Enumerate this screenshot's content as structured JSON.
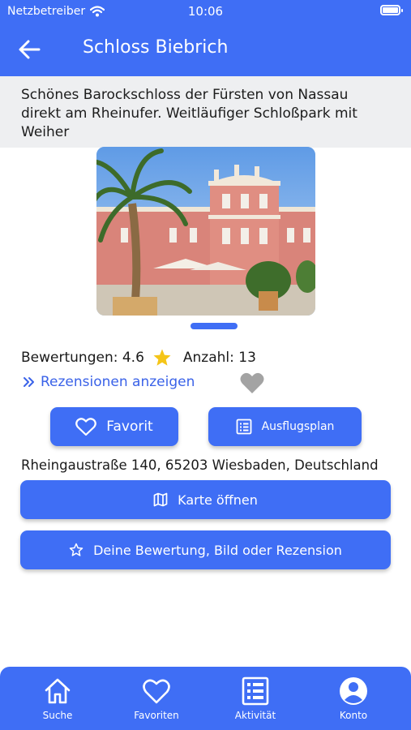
{
  "status_bar": {
    "carrier": "Netzbetreiber",
    "time": "10:06"
  },
  "header": {
    "title": "Schloss Biebrich"
  },
  "description": "Schönes Barockschloss der Fürsten von Nassau direkt am Rheinufer. Weitläufiger Schloßpark mit Weiher",
  "rating": {
    "label": "Bewertungen: 4.6",
    "count_label": "Anzahl: 13"
  },
  "reviews_link": "Rezensionen anzeigen",
  "buttons": {
    "favorite": "Favorit",
    "plan": "Ausflugsplan",
    "map": "Karte öffnen",
    "review": "Deine Bewertung, Bild oder Rezension"
  },
  "address": "Rheingaustraße 140, 65203 Wiesbaden, Deutschland",
  "tabs": [
    {
      "label": "Suche",
      "icon": "home-icon"
    },
    {
      "label": "Favoriten",
      "icon": "heart-icon"
    },
    {
      "label": "Aktivität",
      "icon": "list-icon"
    },
    {
      "label": "Konto",
      "icon": "account-icon"
    }
  ],
  "colors": {
    "primary": "#3f6ef5",
    "link": "#3a62e8",
    "star": "#f5c518",
    "heart_inactive": "#a3a3a3"
  }
}
